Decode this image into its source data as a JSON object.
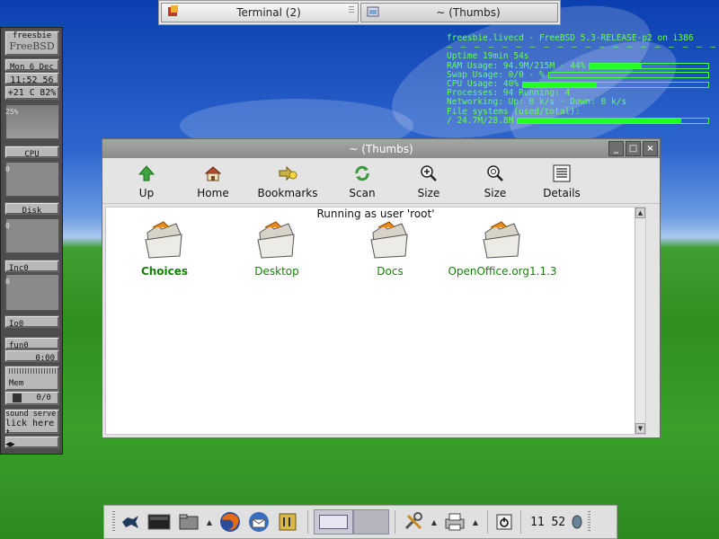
{
  "top_taskbar": {
    "tasks": [
      {
        "label": "Terminal (2)",
        "icon": "terminal-icon"
      },
      {
        "label": "~ (Thumbs)",
        "icon": "window-icon"
      }
    ]
  },
  "dock": {
    "app_title_line1": "freesbie",
    "app_title_line2": "FreeBSD",
    "date": "Mon  6 Dec",
    "time": "11:52 56",
    "temp": "+21 C",
    "battery": "82%",
    "cpu_pct": "25%",
    "cpu_label": "CPU",
    "disk_zero": "0",
    "disk_label": "Disk",
    "disk_zero2": "0",
    "inc_label": "Inc0",
    "inc_zero": "0",
    "io_label": "Io0",
    "fun_label": "fun0",
    "fun_time": "0:00",
    "mem_label": "Mem",
    "vol_value": "0/0",
    "sound_line1": "sound serve",
    "sound_line2": "lick here t"
  },
  "conky": {
    "host_line": "freesbie.livecd - FreeBSD 5.3-RELEASE-p2 on i386",
    "uptime": "Uptime 19min 54s",
    "ram_label": "RAM Usage: 94.9M/215M - 44%",
    "ram_pct": 44,
    "swap_label": "Swap Usage: 0/0 - %",
    "swap_pct": 0,
    "cpu_label": "CPU Usage: 40%",
    "cpu_pct": 40,
    "processes": "Processes: 94   Running: 4",
    "networking": "Networking: Up: 0 k/s - Down: 0 k/s",
    "fs_header": "File systems (used/total):",
    "fs_line": " / 24.7M/28.8M",
    "fs_pct": 86
  },
  "window": {
    "title": "~ (Thumbs)",
    "minimize": "_",
    "maximize": "□",
    "close": "×",
    "toolbar": [
      {
        "label": "Up",
        "icon": "up-arrow-icon"
      },
      {
        "label": "Home",
        "icon": "home-icon"
      },
      {
        "label": "Bookmarks",
        "icon": "bookmarks-icon"
      },
      {
        "label": "Scan",
        "icon": "scan-refresh-icon"
      },
      {
        "label": "Size",
        "icon": "zoom-in-icon"
      },
      {
        "label": "Size",
        "icon": "zoom-fit-icon"
      },
      {
        "label": "Details",
        "icon": "details-list-icon"
      }
    ],
    "status": "Running as user 'root'",
    "folders": [
      {
        "label": "Choices"
      },
      {
        "label": "Desktop"
      },
      {
        "label": "Docs"
      },
      {
        "label": "OpenOffice.org1.1.3"
      }
    ],
    "label_color": "#17800b"
  },
  "panel": {
    "clock": "11 52",
    "icons": [
      "xfce-mouse-icon",
      "window-list-icon",
      "folder-icon",
      "firefox-icon",
      "thunderbird-icon",
      "media-icon",
      "workspace-1",
      "workspace-2",
      "settings-tools-icon",
      "printer-icon",
      "logout-icon",
      "clock-widget",
      "mouse-icon"
    ]
  }
}
